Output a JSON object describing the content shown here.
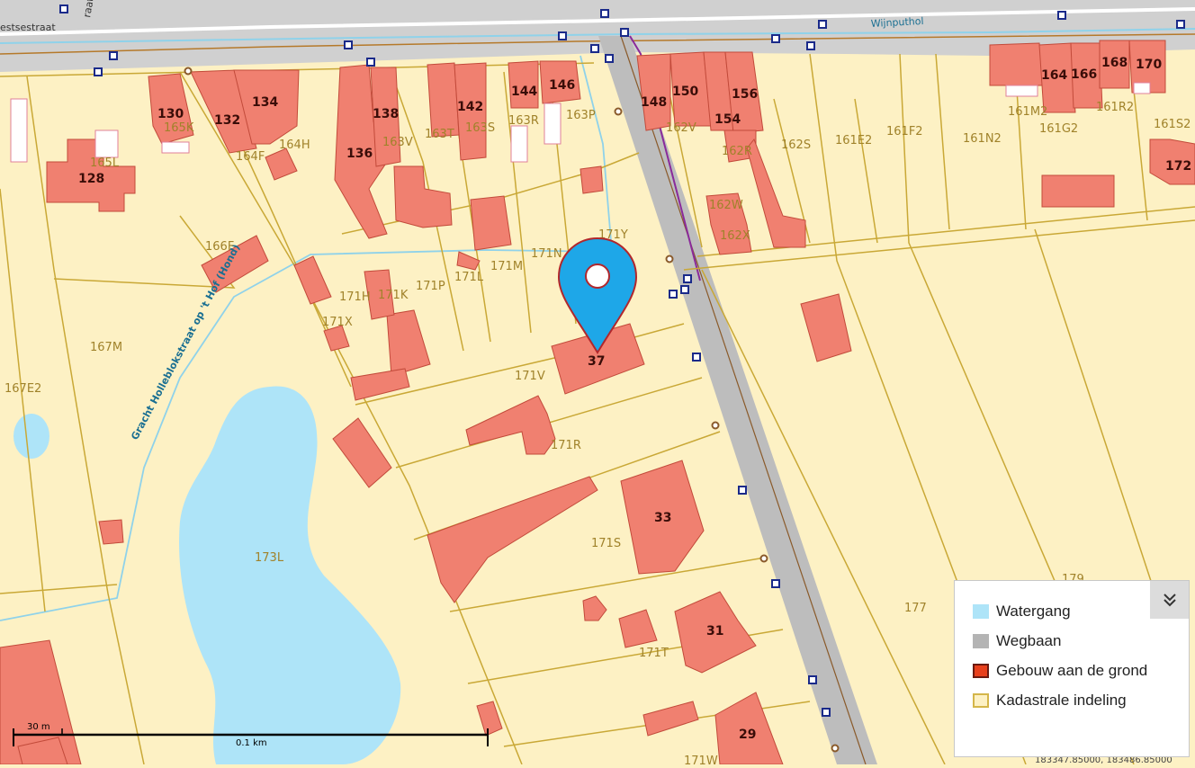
{
  "streets": {
    "street_top_left": "estsestraat",
    "street_top_corner": "raat",
    "street_top_right": "Wijnputhol",
    "canal": "Gracht Holleblokstraat op 't Hof (Hond)"
  },
  "parcels": [
    "165K",
    "165L",
    "164H",
    "164F",
    "163V",
    "163T",
    "163S",
    "163R",
    "163P",
    "162V",
    "162R",
    "162W",
    "162X",
    "162S",
    "161E2",
    "161F2",
    "161N2",
    "161M2",
    "161G2",
    "161R2",
    "161S2",
    "166F",
    "171N",
    "171Y",
    "171M",
    "171L",
    "171K",
    "171H",
    "171P",
    "171X",
    "167M",
    "167E2",
    "171V",
    "171R",
    "171S",
    "173L",
    "171T",
    "171W",
    "177",
    "179"
  ],
  "house_numbers": [
    "128",
    "130",
    "132",
    "134",
    "136",
    "138",
    "142",
    "144",
    "146",
    "148",
    "150",
    "154",
    "156",
    "164",
    "166",
    "168",
    "170",
    "172",
    "37",
    "33",
    "31",
    "29"
  ],
  "marker": {
    "label": "37"
  },
  "scale": {
    "label_top": "30 m",
    "label_bottom": "0.1 km"
  },
  "coords": "183347.85000, 183486.85000",
  "legend": {
    "items": [
      {
        "label": "Watergang",
        "color": "#aee4f8",
        "border": "#aee4f8"
      },
      {
        "label": "Wegbaan",
        "color": "#b4b4b4",
        "border": "#b4b4b4"
      },
      {
        "label": "Gebouw aan de grond",
        "color": "#e8401c",
        "border": "#6b1a10"
      },
      {
        "label": "Kadastrale indeling",
        "color": "#fdf1c4",
        "border": "#d4b64a"
      }
    ]
  },
  "colors": {
    "building": "#f08070",
    "building_dark": "#e86352",
    "parcel": "#fdf1c4",
    "parcel_line": "#c9a836",
    "water": "#aee4f8",
    "road": "#bdbdbd",
    "marker": "#1ea7e8"
  }
}
